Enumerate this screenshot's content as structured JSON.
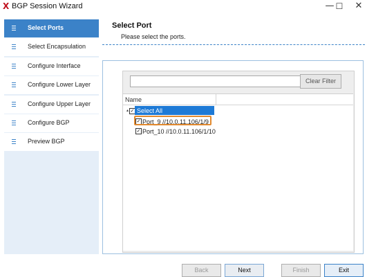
{
  "window": {
    "logo": "X",
    "title": "BGP Session Wizard",
    "minimize": "—",
    "maximize": "☐",
    "close": "✕"
  },
  "sidebar": {
    "items": [
      {
        "label": "Select Ports",
        "active": true
      },
      {
        "label": "Select Encapsulation"
      },
      {
        "label": "Configure Interface"
      },
      {
        "label": "Configure Lower Layer"
      },
      {
        "label": "Configure Upper Layer"
      },
      {
        "label": "Configure BGP"
      },
      {
        "label": "Preview BGP"
      }
    ]
  },
  "header": {
    "title": "Select Port",
    "subtitle": "Please select the ports."
  },
  "filter": {
    "value": "",
    "clear_label": "Clear Filter"
  },
  "tree": {
    "column_name": "Name",
    "expand_glyph": "▴",
    "check_glyph": "✓",
    "select_all": "Select All",
    "ports": [
      {
        "label": "Port_9 //10.0.11.106/1/9",
        "checked": true
      },
      {
        "label": "Port_10 //10.0.11.106/1/10",
        "checked": true
      }
    ]
  },
  "footer": {
    "back": "Back",
    "next": "Next",
    "finish": "Finish",
    "exit": "Exit"
  },
  "colors": {
    "accent": "#3b82c8",
    "selection": "#1e7ad6",
    "highlight": "#e2892e",
    "logo": "#c0121f"
  }
}
